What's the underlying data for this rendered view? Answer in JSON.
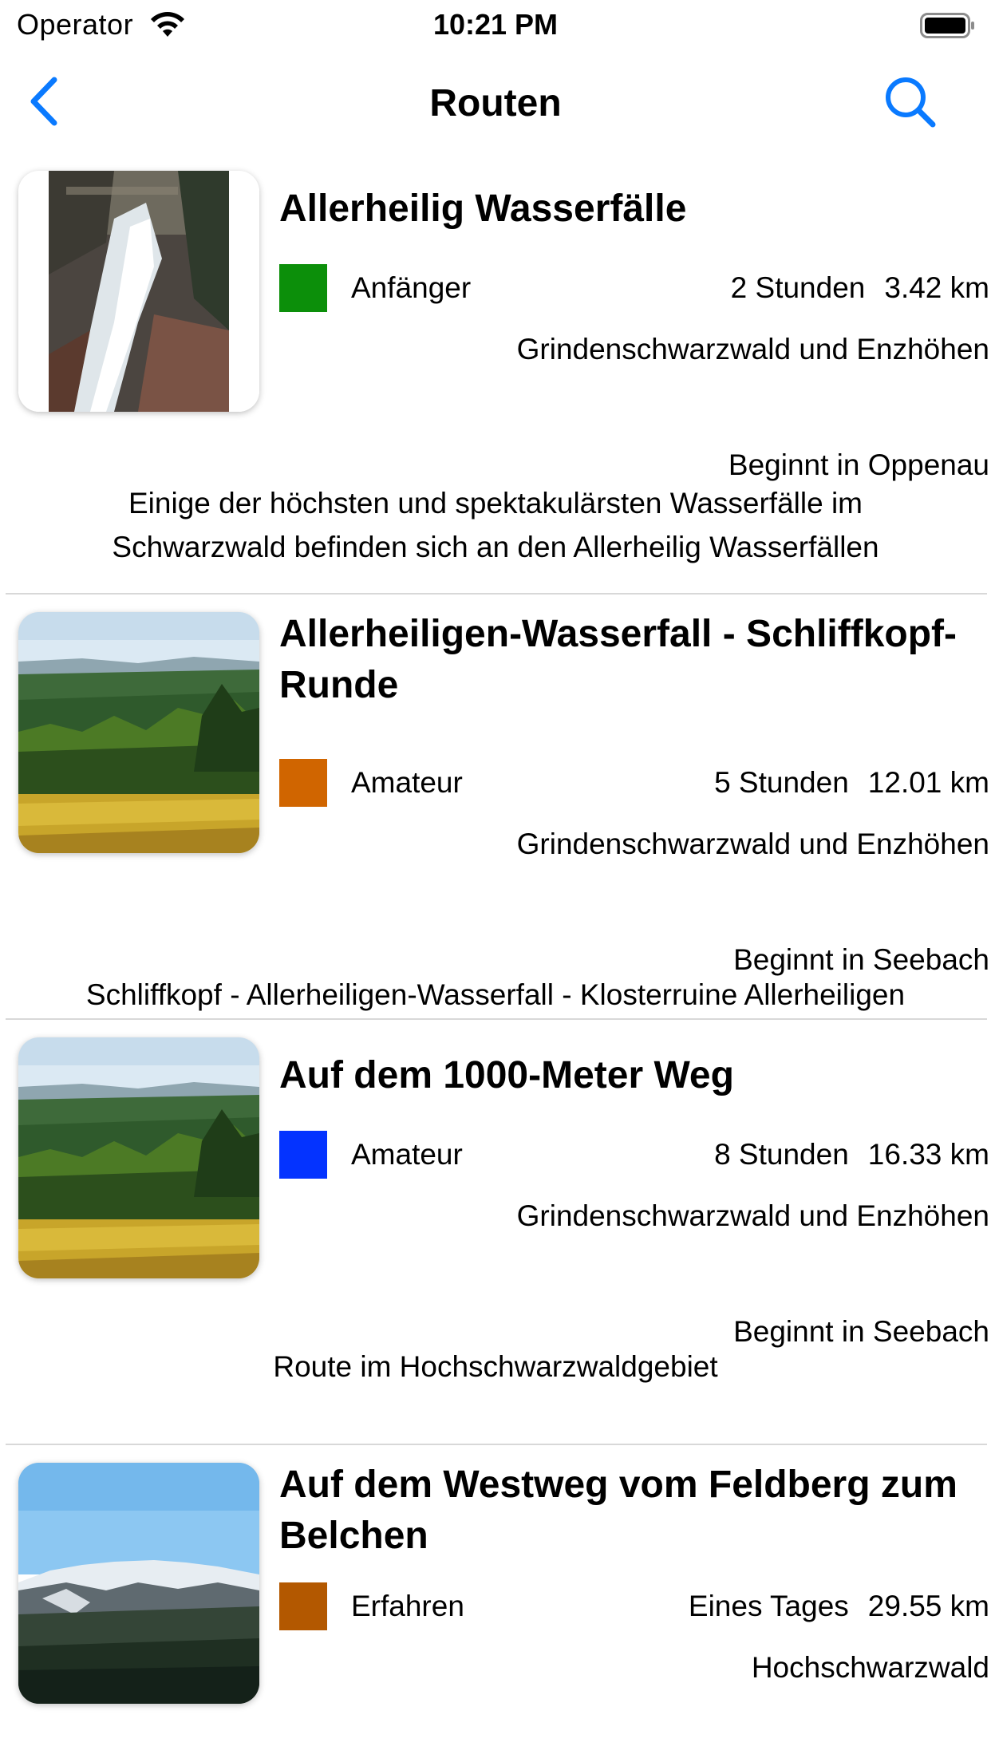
{
  "status_bar": {
    "carrier": "Operator",
    "time": "10:21 PM"
  },
  "nav": {
    "title": "Routen",
    "back_icon": "chevron-left-icon",
    "search_icon": "magnifier-icon",
    "accent_color": "#0a7aff"
  },
  "routes": [
    {
      "name": "Allerheilig Wasserfälle",
      "level": "Anfänger",
      "level_color": "#0c8f0a",
      "duration": "2 Stunden",
      "distance": "3.42 km",
      "region": "Grindenschwarzwald und Enzhöhen",
      "start": "Beginnt in Oppenau",
      "description": "Einige der höchsten und spektakulärsten Wasserfälle im Schwarzwald befinden sich an den Allerheilig Wasserfällen",
      "image": "waterfall"
    },
    {
      "name": "Allerheiligen-Wasserfall - Schliffkopf-Runde",
      "level": "Amateur",
      "level_color": "#d06500",
      "duration": "5 Stunden",
      "distance": "12.01 km",
      "region": "Grindenschwarzwald und Enzhöhen",
      "start": "Beginnt in Seebach",
      "description": "Schliffkopf - Allerheiligen-Wasserfall - Klosterruine Allerheiligen",
      "image": "meadow"
    },
    {
      "name": "Auf dem 1000-Meter Weg",
      "level": "Amateur",
      "level_color": "#0433ff",
      "duration": "8 Stunden",
      "distance": "16.33 km",
      "region": "Grindenschwarzwald und Enzhöhen",
      "start": "Beginnt in Seebach",
      "description": "Route im Hochschwarzwaldgebiet",
      "image": "meadow"
    },
    {
      "name": "Auf dem Westweg vom Feldberg zum Belchen",
      "level": "Erfahren",
      "level_color": "#b35800",
      "duration": "Eines Tages",
      "distance": "29.55 km",
      "region": "Hochschwarzwald",
      "start": "",
      "description": "",
      "image": "mountain"
    }
  ]
}
